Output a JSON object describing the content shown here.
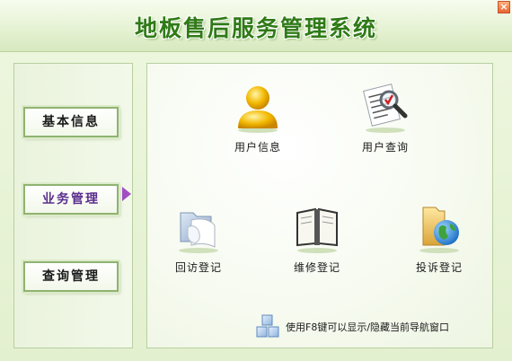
{
  "window": {
    "title": "地板售后服务管理系统",
    "close_label": "×"
  },
  "nav": {
    "items": [
      {
        "label": "基本信息",
        "active": false
      },
      {
        "label": "业务管理",
        "active": true
      },
      {
        "label": "查询管理",
        "active": false
      }
    ]
  },
  "tiles": [
    {
      "label": "用户信息",
      "icon": "user-icon"
    },
    {
      "label": "用户查询",
      "icon": "document-search-icon"
    },
    {
      "label": "回访登记",
      "icon": "folder-scroll-icon"
    },
    {
      "label": "维修登记",
      "icon": "notebook-icon"
    },
    {
      "label": "投诉登记",
      "icon": "folder-globe-icon"
    }
  ],
  "footer": {
    "hint": "使用F8键可以显示/隐藏当前导航窗口",
    "icon": "cubes-icon"
  },
  "colors": {
    "title": "#2f7a16",
    "active_nav": "#5a2d8c",
    "nav_arrow": "#a04fc2"
  }
}
